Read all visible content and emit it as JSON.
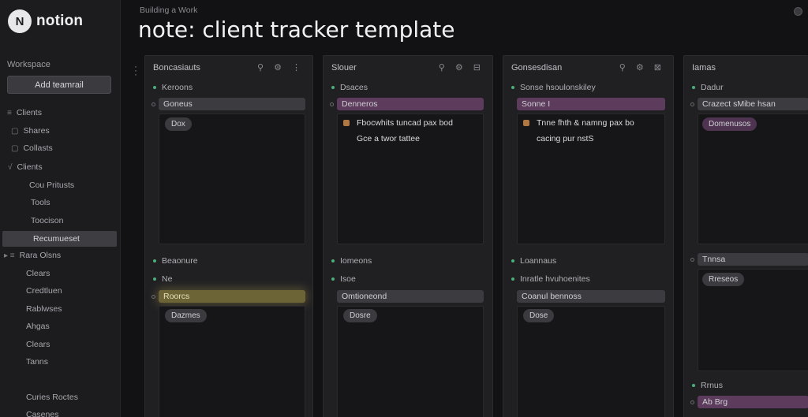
{
  "app": {
    "logo_text": "notion"
  },
  "header": {
    "breadcrumb": "Building a Work",
    "title": "note: client tracker template"
  },
  "sidebar": {
    "heading": "Workspace",
    "button_label": "Add teamrail",
    "items": [
      {
        "prefix": "≡",
        "label": "Clients"
      },
      {
        "prefix": "▢",
        "label": "Shares"
      },
      {
        "prefix": "▢",
        "label": "Collasts"
      },
      {
        "prefix": "√",
        "label": "Clients"
      },
      {
        "prefix": "",
        "label": "Cou Pritusts"
      },
      {
        "prefix": "",
        "label": "Tools"
      },
      {
        "prefix": "",
        "label": "Toocison"
      },
      {
        "prefix": "",
        "label": "Recumueset"
      },
      {
        "prefix": "▸ ≡",
        "label": "Rara Olsns"
      },
      {
        "prefix": "",
        "label": "Clears"
      },
      {
        "prefix": "",
        "label": "Credtluen"
      },
      {
        "prefix": "",
        "label": "Rablwses"
      },
      {
        "prefix": "",
        "label": "Ahgas"
      },
      {
        "prefix": "",
        "label": "Clears"
      },
      {
        "prefix": "",
        "label": "Tanns"
      },
      {
        "prefix": "",
        "label": "Curies Roctes"
      },
      {
        "prefix": "",
        "label": "Casenes"
      }
    ]
  },
  "columns": [
    {
      "title": "Boncasiauts",
      "icons": "⚲ ⚙ ⋮",
      "group1_label": "Keroons",
      "bar1": "Goneus",
      "chip1": "Dox",
      "notes": [],
      "group2_label": "Beaonure",
      "group3_label": "Ne",
      "bar2": "Roorcs",
      "chip2": "Dazmes"
    },
    {
      "title": "Slouer",
      "icons": "⚲ ⚙ ⊟",
      "group1_label": "Dsaces",
      "bar1": "Denneros",
      "chip1": "",
      "notes": [
        "Fbocwhits tuncad pax bod",
        "Gce a twor tattee"
      ],
      "group2_label": "Iomeons",
      "group3_label": "Isoe",
      "bar2": "Omtioneond",
      "chip2": "Dosre"
    },
    {
      "title": "Gonsesdisan",
      "icons": "⚲ ⚙ ⊠",
      "group1_label": "Sonse hsoulonskiley",
      "bar1": "Sonne I",
      "chip1": "",
      "notes": [
        "Tnne fhth & namng pax bo",
        "cacing pur nstS"
      ],
      "group2_label": "Loannaus",
      "group3_label": "Inratle hvuhoenites",
      "bar2": "Coanul bennoss",
      "chip2": "Dose"
    },
    {
      "title": "Iamas",
      "icons": "",
      "group1_label": "Dadur",
      "bar1": "Crazect sMibe hsan",
      "chip1": "Domenusos",
      "notes": [],
      "group2_label": "Tnnsa",
      "group3_label": "Rrnus",
      "bar2": "Ab  Brg",
      "chip2": "Rreseos"
    }
  ],
  "colors": {
    "background": "#121214",
    "sidebar": "#1c1c1f",
    "column": "#202023",
    "accent_purple": "#5c3b5c",
    "accent_yellow": "#6c6336",
    "status_green": "#4cae7a"
  }
}
